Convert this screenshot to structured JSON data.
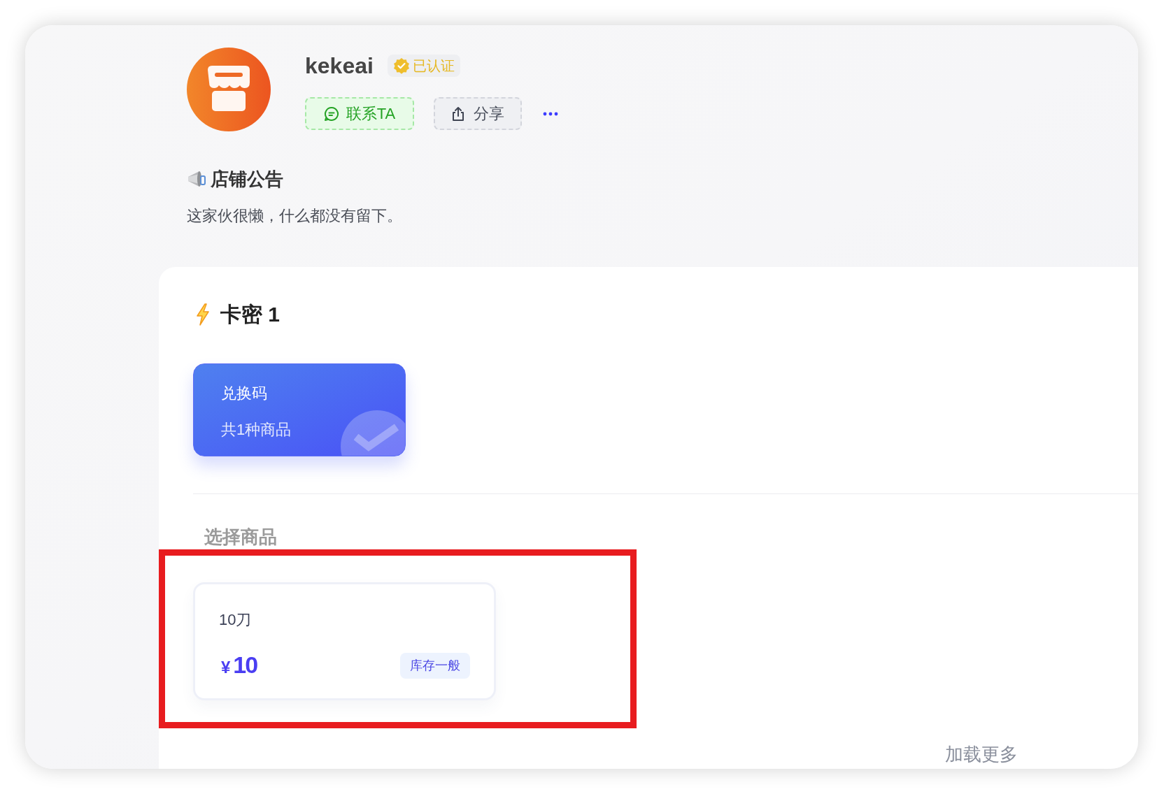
{
  "shop": {
    "name": "kekeai",
    "badge": "已认证",
    "actions": [
      {
        "kind": "contact",
        "label": "联系TA"
      },
      {
        "kind": "share",
        "label": "分享"
      },
      {
        "kind": "more"
      }
    ]
  },
  "notice": {
    "title": "店铺公告",
    "text": "这家伙很懒，什么都没有留下。"
  },
  "category": {
    "title": "卡密 1",
    "types": [
      {
        "name": "兑换码",
        "count": "共1种商品",
        "selected": true
      }
    ]
  },
  "products": {
    "title": "选择商品",
    "highlighted": true,
    "items": [
      {
        "name": "10刀",
        "currency": "¥",
        "price": "10",
        "stock": "库存一般"
      }
    ]
  },
  "load_more": "加载更多"
}
